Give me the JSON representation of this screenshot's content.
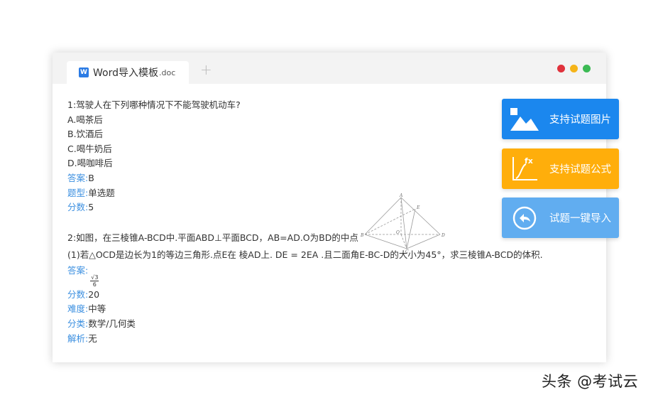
{
  "window": {
    "tab": {
      "name": "Word导入模板",
      "ext": ".doc",
      "icon_letter": "W",
      "icon": "word-file-icon"
    },
    "add_tab_symbol": "+",
    "controls": {
      "close_color": "#e0323c",
      "minimize_color": "#f5b419",
      "maximize_color": "#3cba54"
    }
  },
  "question1": {
    "stem": "1:驾驶人在下列哪种情况下不能驾驶机动车?",
    "options": [
      "A.喝茶后",
      "B.饮酒后",
      "C.喝牛奶后",
      "D.喝咖啡后"
    ],
    "answer_label": "答案:",
    "answer": "B",
    "type_label": "题型:",
    "type": "单选题",
    "score_label": "分数:",
    "score": "5"
  },
  "question2": {
    "stem": "2:如图，在三棱锥A-BCD中.平面ABD⊥平面BCD，AB=AD.O为BD的中点",
    "sub": "(1)若△OCD是边长为1的等边三角形.点E在 棱AD上. DE = 2EA .且二面角E-BC-D的大小为45°，求三棱锥A-BCD的体积.",
    "answer_label": "答案:",
    "answer_num": "√3",
    "answer_den": "6",
    "score_label": "分数:",
    "score": "20",
    "difficulty_label": "难度:",
    "difficulty": "中等",
    "category_label": "分类:",
    "category": "数学/几何类",
    "analysis_label": "解析:",
    "analysis": "无",
    "figure_labels": {
      "a": "A",
      "b": "B",
      "c": "C",
      "d": "D",
      "e": "E",
      "o": "O"
    }
  },
  "features": [
    {
      "label": "支持试题图片",
      "icon": "image-icon",
      "color": "#1b87ee"
    },
    {
      "label": "支持试题公式",
      "icon": "formula-icon",
      "icon_text": "fx",
      "color": "#ffae0b"
    },
    {
      "label": "试题一键导入",
      "icon": "import-icon",
      "color": "#61adf0"
    }
  ],
  "watermark": "头条 @考试云"
}
